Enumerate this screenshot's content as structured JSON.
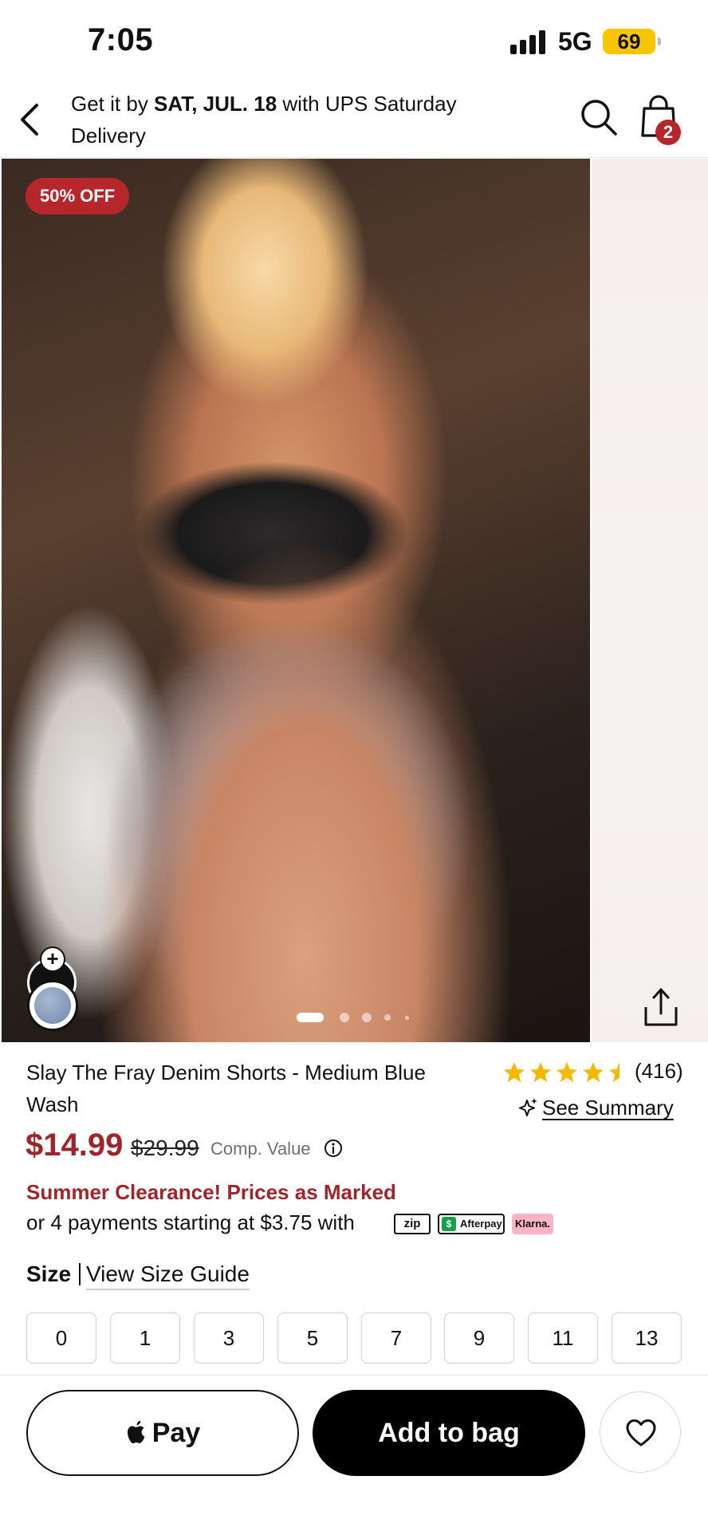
{
  "status_bar": {
    "time": "7:05",
    "network": "5G",
    "battery": "69"
  },
  "header": {
    "delivery_prefix": "Get it by ",
    "delivery_date": "SAT, JUL. 18",
    "delivery_suffix": " with UPS Saturday Delivery",
    "bag_count": "2"
  },
  "hero": {
    "discount_badge": "50% OFF",
    "add_swatch_symbol": "+",
    "image_count": 5,
    "active_image_index": 0
  },
  "product": {
    "title": "Slay The Fray Denim Shorts - Medium Blue Wash",
    "rating": 4.5,
    "review_count": "(416)",
    "see_summary": "See Summary",
    "price": "$14.99",
    "original_price": "$29.99",
    "comp_value_label": "Comp. Value",
    "promo": "Summer Clearance! Prices as Marked",
    "payments_text": "or 4 payments starting at $3.75 with",
    "payment_providers": {
      "zip": "zip",
      "afterpay": "Afterpay",
      "klarna": "Klarna."
    }
  },
  "size_section": {
    "label": "Size",
    "guide_link": "View Size Guide",
    "options": [
      "0",
      "1",
      "3",
      "5",
      "7",
      "9",
      "11",
      "13"
    ]
  },
  "actions": {
    "apple_pay_label": "Pay",
    "add_to_bag_label": "Add to bag"
  },
  "colors": {
    "accent_red": "#a0252b",
    "badge_red": "#b7262b",
    "star_gold": "#f5b800",
    "selected_swatch": "#7d94b6"
  },
  "icons": [
    "back-chevron-icon",
    "search-icon",
    "shopping-bag-icon",
    "share-icon",
    "sparkle-icon",
    "info-icon",
    "apple-logo-icon",
    "heart-icon",
    "star-icon"
  ]
}
